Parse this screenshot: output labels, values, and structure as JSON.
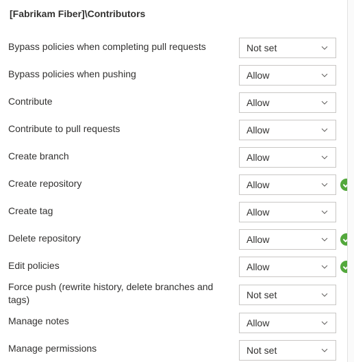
{
  "header": {
    "title": "[Fabrikam Fiber]\\Contributors"
  },
  "colors": {
    "success": "#53a83c",
    "border": "#c8c6c4"
  },
  "permissions": [
    {
      "label": "Bypass policies when completing pull requests",
      "value": "Not set",
      "status": "none"
    },
    {
      "label": "Bypass policies when pushing",
      "value": "Allow",
      "status": "none"
    },
    {
      "label": "Contribute",
      "value": "Allow",
      "status": "none"
    },
    {
      "label": "Contribute to pull requests",
      "value": "Allow",
      "status": "none"
    },
    {
      "label": "Create branch",
      "value": "Allow",
      "status": "none"
    },
    {
      "label": "Create repository",
      "value": "Allow",
      "status": "success"
    },
    {
      "label": "Create tag",
      "value": "Allow",
      "status": "none"
    },
    {
      "label": "Delete repository",
      "value": "Allow",
      "status": "success"
    },
    {
      "label": "Edit policies",
      "value": "Allow",
      "status": "success"
    },
    {
      "label": "Force push (rewrite history, delete branches and tags)",
      "value": "Not set",
      "status": "none"
    },
    {
      "label": "Manage notes",
      "value": "Allow",
      "status": "none"
    },
    {
      "label": "Manage permissions",
      "value": "Not set",
      "status": "none"
    }
  ]
}
